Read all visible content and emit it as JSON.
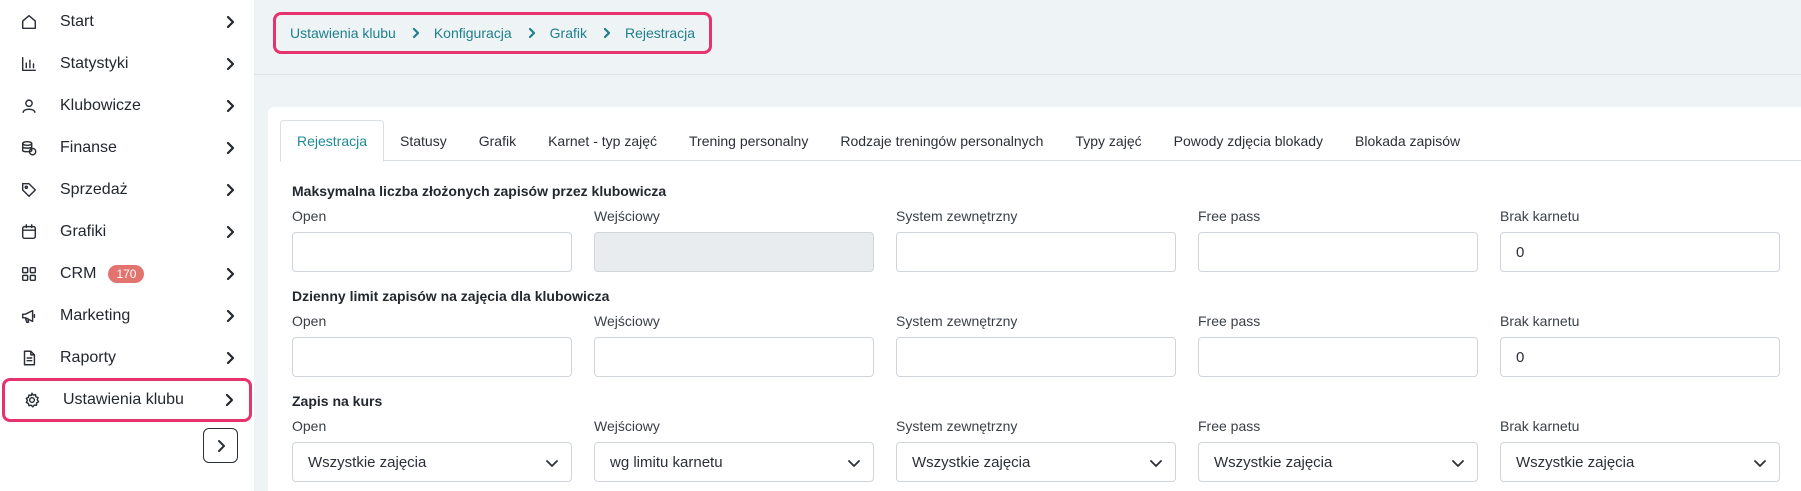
{
  "sidebar": {
    "items": [
      {
        "label": "Start",
        "icon": "home-icon"
      },
      {
        "label": "Statystyki",
        "icon": "bar-chart-icon"
      },
      {
        "label": "Klubowicze",
        "icon": "user-icon"
      },
      {
        "label": "Finanse",
        "icon": "coins-icon"
      },
      {
        "label": "Sprzedaż",
        "icon": "tag-icon"
      },
      {
        "label": "Grafiki",
        "icon": "calendar-icon"
      },
      {
        "label": "CRM",
        "icon": "grid-icon",
        "badge": "170"
      },
      {
        "label": "Marketing",
        "icon": "megaphone-icon"
      },
      {
        "label": "Raporty",
        "icon": "document-icon"
      },
      {
        "label": "Ustawienia klubu",
        "icon": "gear-icon"
      }
    ]
  },
  "breadcrumb": [
    "Ustawienia klubu",
    "Konfiguracja",
    "Grafik",
    "Rejestracja"
  ],
  "tabs": [
    "Rejestracja",
    "Statusy",
    "Grafik",
    "Karnet - typ zajęć",
    "Trening personalny",
    "Rodzaje treningów personalnych",
    "Typy zajęć",
    "Powody zdjęcia blokady",
    "Blokada zapisów"
  ],
  "sections": [
    {
      "title": "Maksymalna liczba złożonych zapisów przez klubowicza",
      "fields": [
        {
          "label": "Open",
          "value": ""
        },
        {
          "label": "Wejściowy",
          "value": ""
        },
        {
          "label": "System zewnętrzny",
          "value": ""
        },
        {
          "label": "Free pass",
          "value": ""
        },
        {
          "label": "Brak karnetu",
          "value": "0"
        }
      ]
    },
    {
      "title": "Dzienny limit zapisów na zajęcia dla klubowicza",
      "fields": [
        {
          "label": "Open",
          "value": ""
        },
        {
          "label": "Wejściowy",
          "value": ""
        },
        {
          "label": "System zewnętrzny",
          "value": ""
        },
        {
          "label": "Free pass",
          "value": ""
        },
        {
          "label": "Brak karnetu",
          "value": "0"
        }
      ]
    },
    {
      "title": "Zapis na kurs",
      "fields": [
        {
          "label": "Open",
          "value": "Wszystkie zajęcia"
        },
        {
          "label": "Wejściowy",
          "value": "wg limitu karnetu"
        },
        {
          "label": "System zewnętrzny",
          "value": "Wszystkie zajęcia"
        },
        {
          "label": "Free pass",
          "value": "Wszystkie zajęcia"
        },
        {
          "label": "Brak karnetu",
          "value": "Wszystkie zajęcia"
        }
      ]
    }
  ],
  "colors": {
    "accent": "#1f8a96",
    "highlight": "#e6336d",
    "badge": "#e2736f"
  }
}
